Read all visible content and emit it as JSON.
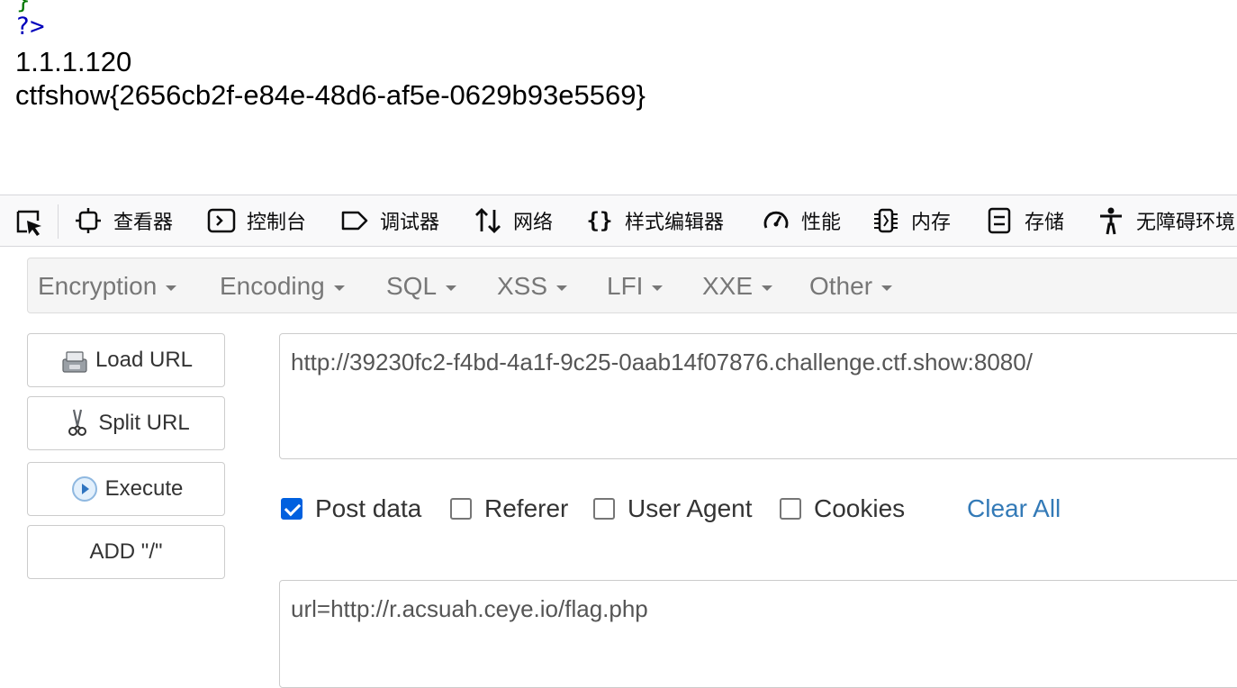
{
  "page_output": {
    "code_brace": "}",
    "php_close": "?>",
    "ip": "1.1.1.120",
    "flag": "ctfshow{2656cb2f-e84e-48d6-af5e-0629b93e5569}"
  },
  "devtools": {
    "tabs": [
      {
        "label": "查看器",
        "icon": "inspector-icon"
      },
      {
        "label": "控制台",
        "icon": "console-icon"
      },
      {
        "label": "调试器",
        "icon": "debugger-icon"
      },
      {
        "label": "网络",
        "icon": "network-icon"
      },
      {
        "label": "样式编辑器",
        "icon": "style-editor-icon"
      },
      {
        "label": "性能",
        "icon": "performance-icon"
      },
      {
        "label": "内存",
        "icon": "memory-icon"
      },
      {
        "label": "存储",
        "icon": "storage-icon"
      },
      {
        "label": "无障碍环境",
        "icon": "accessibility-icon"
      }
    ]
  },
  "hackbar": {
    "menu": [
      "Encryption",
      "Encoding",
      "SQL",
      "XSS",
      "LFI",
      "XXE",
      "Other"
    ],
    "buttons": {
      "load_url": "Load URL",
      "split_url": "Split URL",
      "execute": "Execute",
      "add_slash": "ADD \"/\""
    },
    "url_value": "http://39230fc2-f4bd-4a1f-9c25-0aab14f07876.challenge.ctf.show:8080/",
    "options": {
      "post_data": {
        "label": "Post data",
        "checked": true
      },
      "referer": {
        "label": "Referer",
        "checked": false
      },
      "user_agent": {
        "label": "User Agent",
        "checked": false
      },
      "cookies": {
        "label": "Cookies",
        "checked": false
      }
    },
    "clear_all": "Clear All",
    "post_value": "url=http://r.acsuah.ceye.io/flag.php"
  },
  "colors": {
    "accent": "#0060df",
    "link": "#337ab7",
    "php_keyword": "#0000bb",
    "php_brace": "#007700"
  }
}
